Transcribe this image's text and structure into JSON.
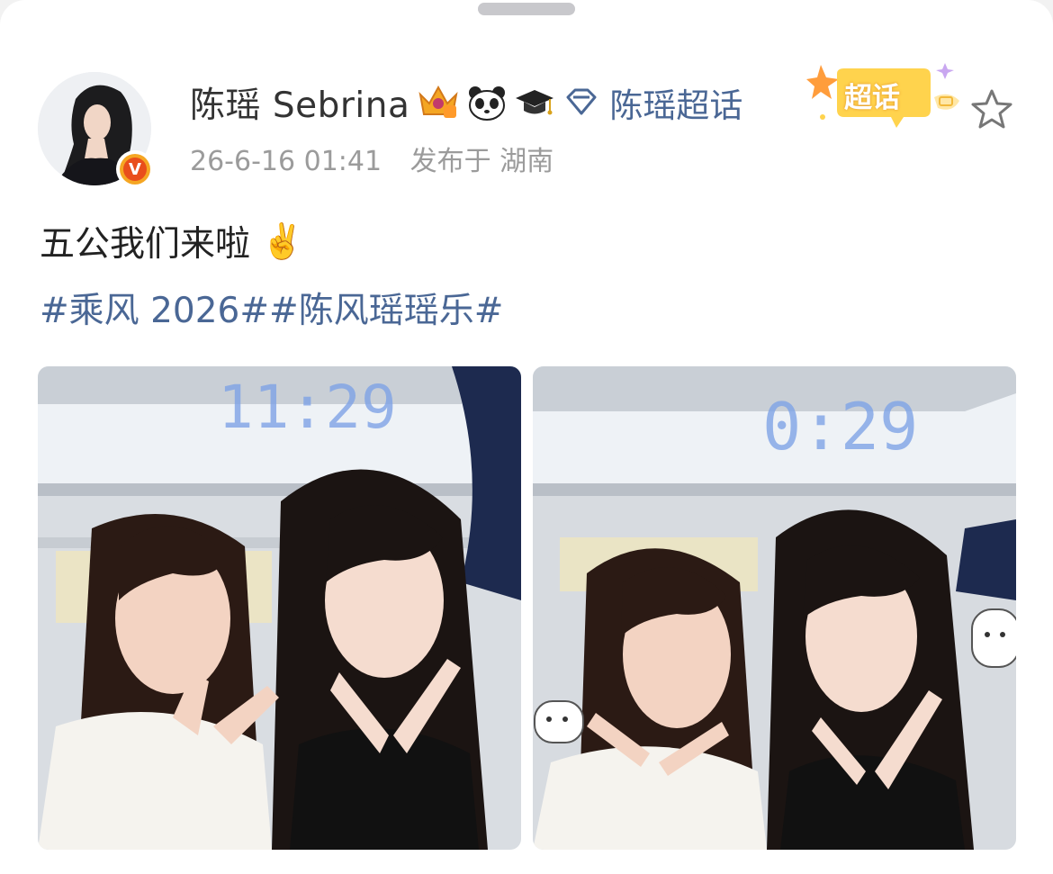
{
  "post": {
    "author": "陈瑶 Sebrina",
    "chaohua_link": "陈瑶超话",
    "chaohua_sticker": "超话",
    "timestamp": "26-6-16 01:41",
    "location": "发布于 湖南",
    "text": "五公我们来啦",
    "text_emoji": "✌️",
    "hashtags": [
      "#乘风 2026#",
      "#陈风瑶瑶乐#"
    ],
    "verified_badge": "V",
    "photo_clock": [
      "11:29",
      "0:29"
    ]
  },
  "icons": {
    "avatar": "avatar",
    "verified": "verified-v-badge-icon",
    "crown": "crown-level-badge-icon",
    "panda": "panda-badge-icon",
    "grad_cap": "graduation-cap-badge-icon",
    "diamond": "diamond-chaohua-icon",
    "star": "star-favorite-icon"
  },
  "colors": {
    "link_blue": "#4a6795",
    "text_dark": "#222222",
    "meta_gray": "#9b9b9b",
    "verified_orange": "#e94e1b",
    "sticker_yellow": "#ffd34d"
  }
}
